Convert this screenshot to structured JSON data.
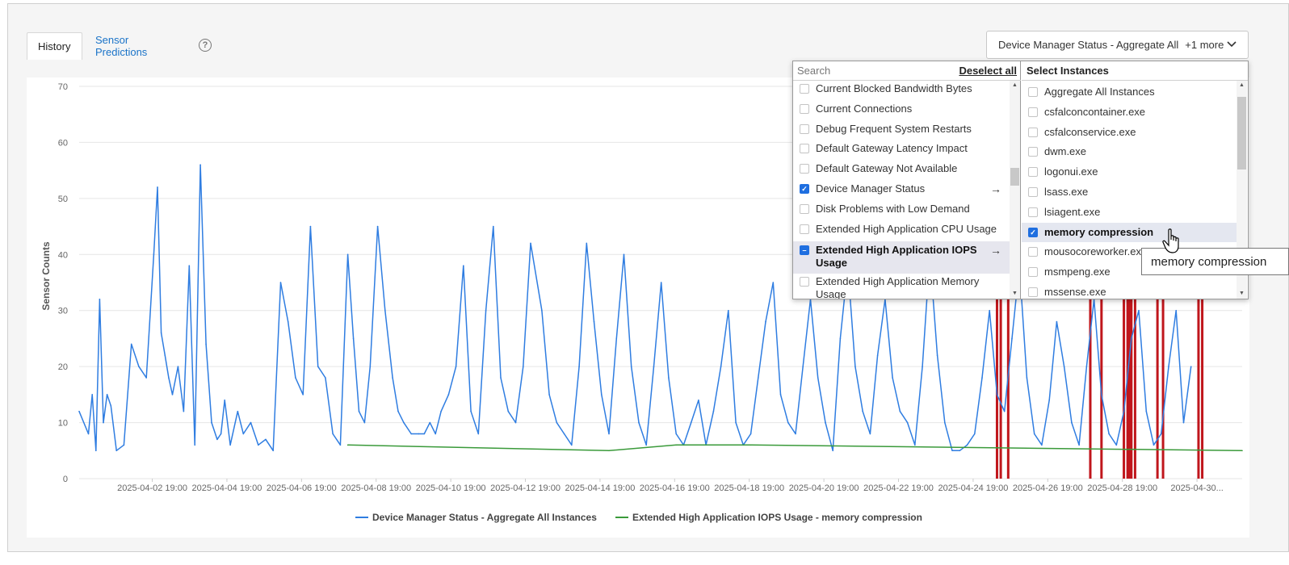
{
  "tabs": {
    "history": "History",
    "predictions": "Sensor Predictions"
  },
  "help_glyph": "?",
  "sensor_select": {
    "value": "Device Manager Status - Aggregate All",
    "more": "+1 more"
  },
  "sensor_dropdown": {
    "search_placeholder": "Search",
    "deselect_all": "Deselect all",
    "items": [
      {
        "label": "Current Blocked Bandwidth Bytes",
        "checked": false
      },
      {
        "label": "Current Connections",
        "checked": false
      },
      {
        "label": "Debug Frequent System Restarts",
        "checked": false
      },
      {
        "label": "Default Gateway Latency Impact",
        "checked": false
      },
      {
        "label": "Default Gateway Not Available",
        "checked": false
      },
      {
        "label": "Device Manager Status",
        "checked": true,
        "arrow": true
      },
      {
        "label": "Disk Problems with Low Demand",
        "checked": false
      },
      {
        "label": "Extended High Application CPU Usage",
        "checked": false
      },
      {
        "label": "Extended High Application IOPS Usage",
        "partial": true,
        "arrow": true,
        "selected": true
      },
      {
        "label": "Extended High Application Memory Usage",
        "checked": false
      }
    ],
    "arrow_glyph": "→",
    "check_glyph": "✓",
    "partial_glyph": "–"
  },
  "instances": {
    "title": "Select Instances",
    "items": [
      {
        "label": "Aggregate All Instances",
        "checked": false
      },
      {
        "label": "csfalconcontainer.exe",
        "checked": false
      },
      {
        "label": "csfalconservice.exe",
        "checked": false
      },
      {
        "label": "dwm.exe",
        "checked": false
      },
      {
        "label": "logonui.exe",
        "checked": false
      },
      {
        "label": "lsass.exe",
        "checked": false
      },
      {
        "label": "lsiagent.exe",
        "checked": false
      },
      {
        "label": "memory compression",
        "checked": true,
        "hovered": true
      },
      {
        "label": "mousocoreworker.exe",
        "checked": false
      },
      {
        "label": "msmpeng.exe",
        "checked": false
      },
      {
        "label": "mssense.exe",
        "checked": false
      }
    ]
  },
  "tooltip": "memory compression",
  "chart_data": {
    "type": "line",
    "ylabel": "Sensor Counts",
    "ylim": [
      0,
      70
    ],
    "yticks": [
      0,
      10,
      20,
      30,
      40,
      50,
      60,
      70
    ],
    "x_tick_labels": [
      "2025-04-02 19:00",
      "2025-04-04 19:00",
      "2025-04-06 19:00",
      "2025-04-08 19:00",
      "2025-04-10 19:00",
      "2025-04-12 19:00",
      "2025-04-14 19:00",
      "2025-04-16 19:00",
      "2025-04-18 19:00",
      "2025-04-20 19:00",
      "2025-04-22 19:00",
      "2025-04-24 19:00",
      "2025-04-26 19:00",
      "2025-04-28 19:00",
      "2025-04-30..."
    ],
    "x_tick_days": [
      1.96,
      3.96,
      5.96,
      7.96,
      9.96,
      11.96,
      13.96,
      15.96,
      17.96,
      19.96,
      21.96,
      23.96,
      25.96,
      27.96,
      29.96
    ],
    "xlim_days": [
      0.0,
      31.17
    ],
    "grid": true,
    "legend_position": "bottom",
    "series": [
      {
        "name": "Device Manager Status - Aggregate All Instances",
        "color": "#2f7de1",
        "x_days": [
          0.0,
          0.25,
          0.35,
          0.45,
          0.55,
          0.65,
          0.75,
          0.85,
          1.0,
          1.2,
          1.4,
          1.6,
          1.8,
          2.0,
          2.1,
          2.2,
          2.3,
          2.4,
          2.5,
          2.65,
          2.8,
          2.95,
          3.1,
          3.25,
          3.4,
          3.55,
          3.7,
          3.8,
          3.9,
          4.05,
          4.25,
          4.4,
          4.6,
          4.8,
          5.0,
          5.2,
          5.4,
          5.6,
          5.8,
          6.0,
          6.2,
          6.4,
          6.6,
          6.8,
          7.0,
          7.2,
          7.35,
          7.5,
          7.65,
          7.8,
          8.0,
          8.2,
          8.4,
          8.55,
          8.7,
          8.9,
          9.1,
          9.25,
          9.4,
          9.55,
          9.7,
          9.9,
          10.1,
          10.3,
          10.5,
          10.7,
          10.9,
          11.1,
          11.3,
          11.5,
          11.7,
          11.9,
          12.1,
          12.4,
          12.6,
          12.8,
          13.0,
          13.2,
          13.4,
          13.6,
          13.8,
          14.0,
          14.2,
          14.4,
          14.6,
          14.8,
          15.0,
          15.2,
          15.4,
          15.6,
          15.8,
          16.0,
          16.2,
          16.4,
          16.6,
          16.8,
          17.0,
          17.2,
          17.4,
          17.6,
          17.8,
          18.0,
          18.2,
          18.4,
          18.6,
          18.8,
          19.0,
          19.2,
          19.4,
          19.6,
          19.8,
          20.0,
          20.2,
          20.4,
          20.6,
          20.8,
          21.0,
          21.2,
          21.4,
          21.6,
          21.8,
          22.0,
          22.2,
          22.4,
          22.6,
          22.8,
          23.0,
          23.2,
          23.4,
          23.6,
          23.8,
          24.0,
          24.2,
          24.4,
          24.6,
          24.8,
          25.0,
          25.2,
          25.4,
          25.6,
          25.8,
          26.0,
          26.2,
          26.4,
          26.6,
          26.8,
          27.0,
          27.2,
          27.4,
          27.6,
          27.8,
          28.0,
          28.2,
          28.4,
          28.6,
          28.8,
          29.0,
          29.2,
          29.4,
          29.6,
          29.8,
          30.0,
          30.2,
          30.4,
          30.6,
          30.8,
          31.0,
          31.17
        ],
        "values": [
          12,
          8,
          15,
          5,
          32,
          10,
          15,
          13,
          5,
          6,
          24,
          20,
          18,
          40,
          52,
          26,
          22,
          18,
          15,
          20,
          12,
          38,
          6,
          56,
          24,
          10,
          7,
          8,
          14,
          6,
          12,
          8,
          10,
          6,
          7,
          5,
          35,
          28,
          18,
          15,
          45,
          20,
          18,
          8,
          6,
          40,
          25,
          12,
          10,
          20,
          45,
          30,
          18,
          12,
          10,
          8,
          8,
          8,
          10,
          8,
          12,
          15,
          20,
          38,
          12,
          8,
          30,
          45,
          18,
          12,
          10,
          20,
          42,
          30,
          15,
          10,
          8,
          6,
          20,
          42,
          28,
          15,
          8,
          25,
          40,
          20,
          10,
          6,
          20,
          35,
          18,
          8,
          6,
          10,
          14,
          6,
          12,
          20,
          30,
          10,
          6,
          8,
          18,
          28,
          35,
          15,
          10,
          8,
          20,
          32,
          18,
          10,
          5,
          25,
          38,
          20,
          12,
          8,
          22,
          32,
          18,
          12,
          10,
          6,
          20,
          40,
          22,
          10,
          5,
          5,
          6,
          8,
          18,
          30,
          15,
          12,
          25,
          38,
          18,
          8,
          6,
          14,
          28,
          20,
          10,
          6,
          20,
          32,
          15,
          8,
          6,
          12,
          25,
          30,
          12,
          6,
          8,
          20,
          30,
          10,
          20
        ],
        "note": "approximate trace"
      },
      {
        "name": "Extended High Application IOPS Usage - memory compression",
        "color": "#3a9a3a",
        "x_days": [
          7.2,
          14.2,
          16.0,
          18.0,
          31.17
        ],
        "values": [
          6,
          5,
          6,
          6,
          5
        ]
      }
    ],
    "alert_bars": {
      "color": "#c0161c",
      "days": [
        24.6,
        24.7,
        24.9,
        27.1,
        27.4,
        28.0,
        28.1,
        28.15,
        28.2,
        28.3,
        28.9,
        29.05,
        30.0,
        30.1
      ],
      "note": "red markers from 0 up to the chart top"
    }
  }
}
